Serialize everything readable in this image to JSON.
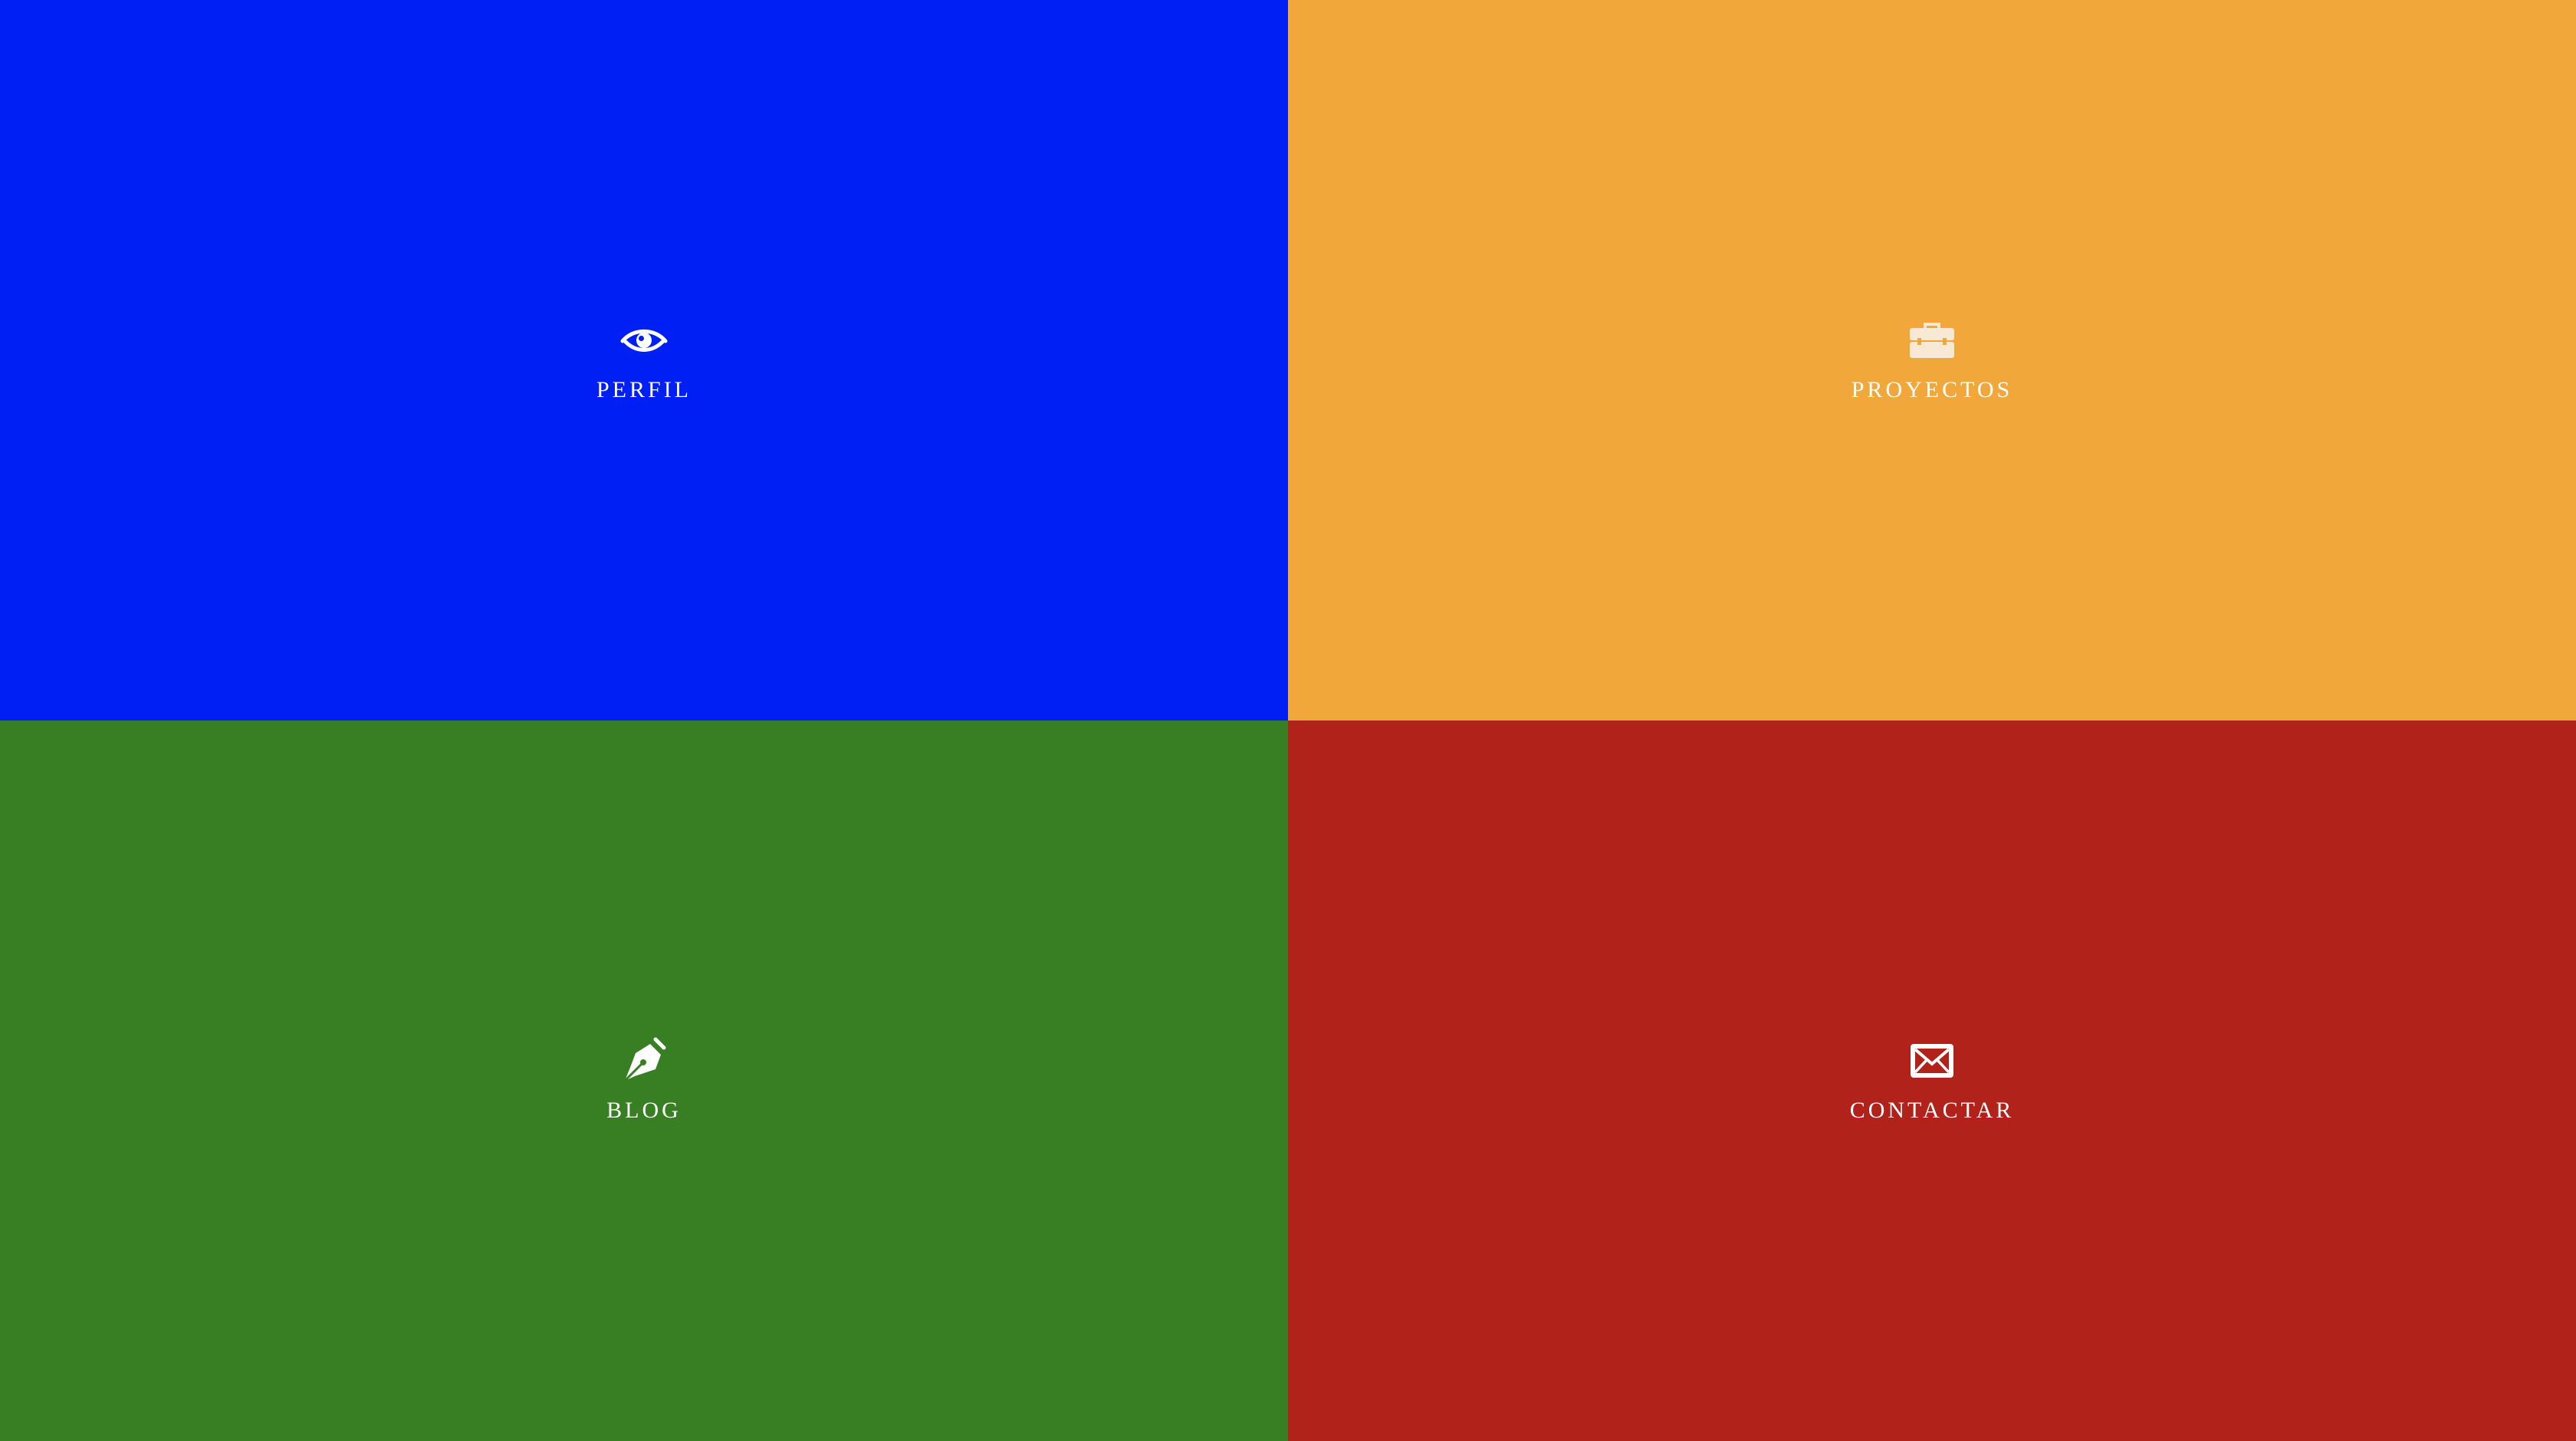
{
  "tiles": [
    {
      "label": "PERFIL",
      "icon": "eye-icon",
      "color": "#001ff5"
    },
    {
      "label": "PROYECTOS",
      "icon": "briefcase-icon",
      "color": "#f2a73b"
    },
    {
      "label": "BLOG",
      "icon": "pen-nib-icon",
      "color": "#387e22"
    },
    {
      "label": "CONTACTAR",
      "icon": "envelope-icon",
      "color": "#b1221a"
    }
  ]
}
